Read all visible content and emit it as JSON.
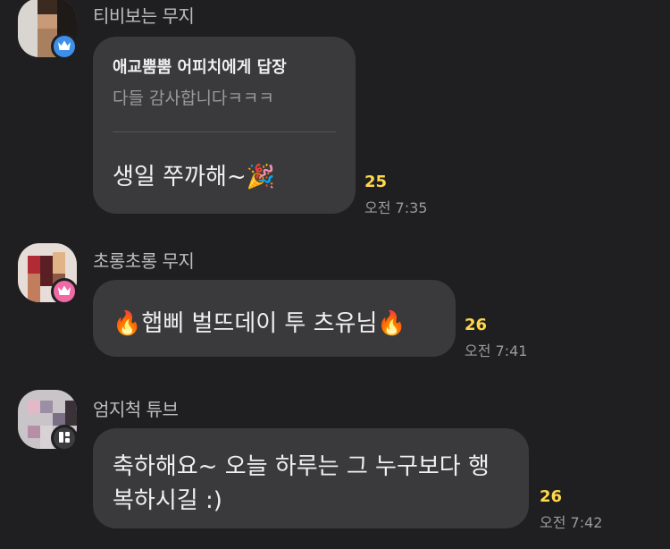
{
  "messages": [
    {
      "sender": "티비보는 무지",
      "reply_to": "애교뿜뿜 어피치에게 답장",
      "reply_quote": "다들 감사합니다ㅋㅋㅋ",
      "text": "생일 쭈까해~🎉",
      "count": "25",
      "time": "오전 7:35",
      "badge_icon": "crown-icon",
      "badge_color": "#3d8fe8"
    },
    {
      "sender": "초롱초롱 무지",
      "text": "🔥햅삐 벌뜨데이 투 츠유님🔥",
      "count": "26",
      "time": "오전 7:41",
      "badge_icon": "crown-icon",
      "badge_color": "#f06aa6"
    },
    {
      "sender": "엄지척 튜브",
      "text_line1": "축하해요~ 오늘 하루는 그 누구보다 행",
      "text_line2": "복하시길 :)",
      "count": "26",
      "time": "오전 7:42",
      "badge_icon": "app-grid-icon",
      "badge_color": "#3d3d3f"
    }
  ]
}
